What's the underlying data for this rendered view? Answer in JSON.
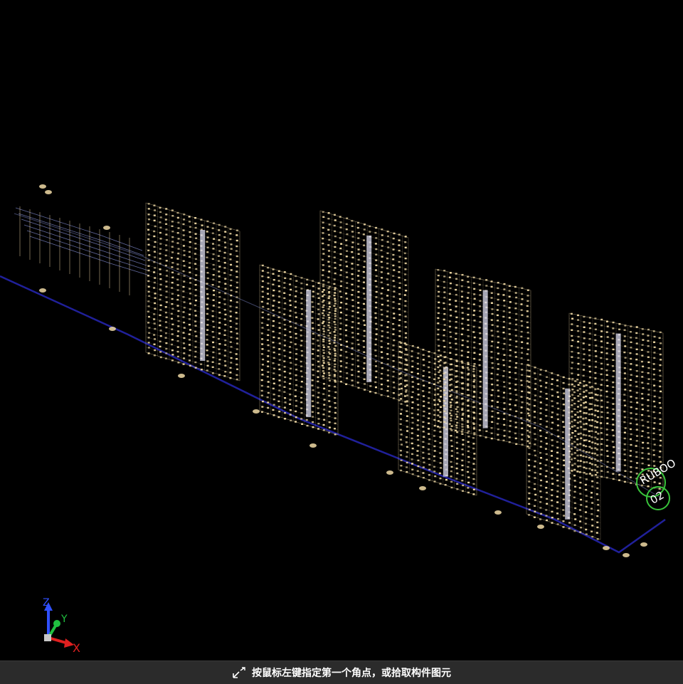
{
  "viewport": {
    "background": "#000000",
    "wire_color": "#f1dba6",
    "structure_color": "#7a83c4",
    "core_color": "#dcdcf0",
    "road_color": "#20209a",
    "marker_color": "#39c43b",
    "marker_text": "RUBOO",
    "marker_text_b": "02"
  },
  "axis_triad": {
    "x_label": "X",
    "y_label": "Y",
    "z_label": "Z",
    "x_color": "#e02020",
    "y_color": "#20c040",
    "z_color": "#3050ff"
  },
  "status": {
    "icon": "corner-pick-icon",
    "hint": "按鼠标左键指定第一个角点，或拾取构件图元"
  }
}
